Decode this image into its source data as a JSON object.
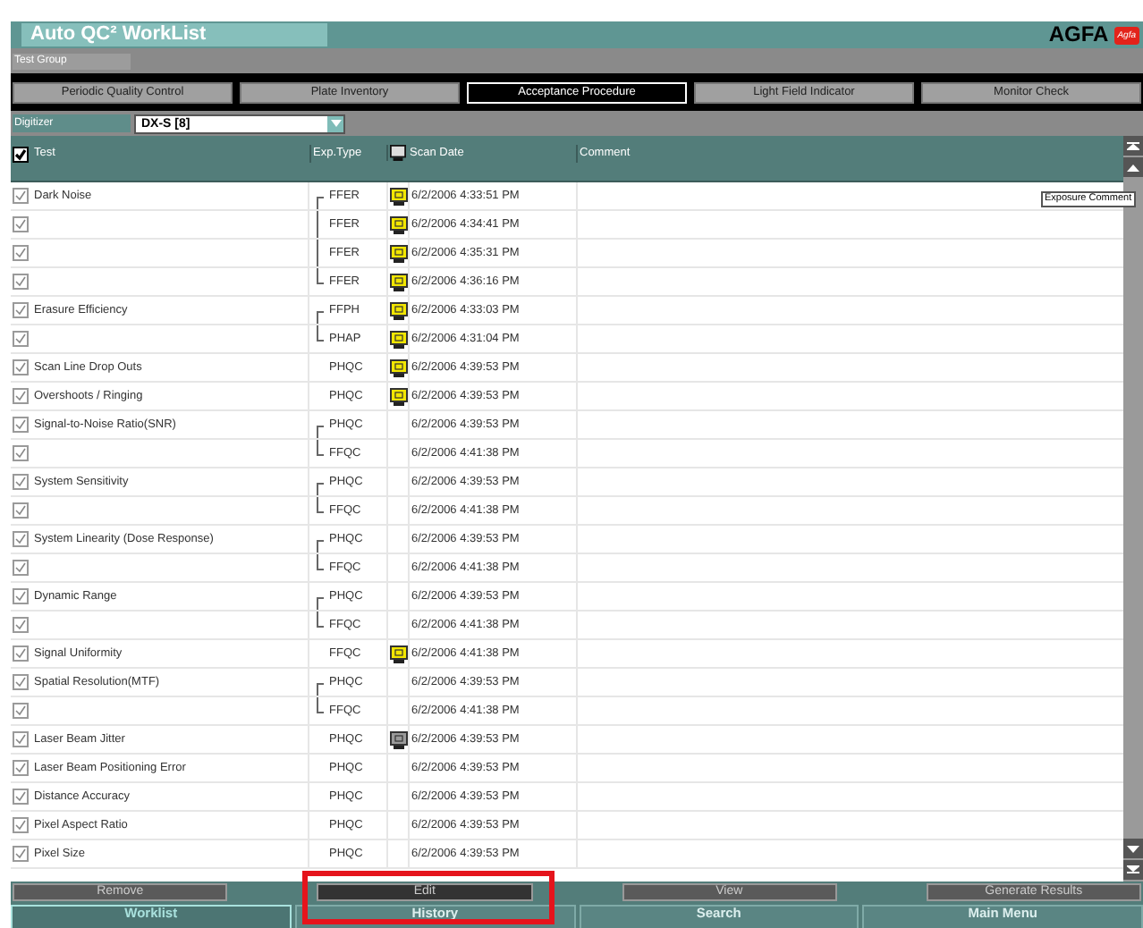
{
  "window": {
    "title": "Auto QC² WorkList",
    "brand": "AGFA",
    "brand_badge": "Agfa"
  },
  "test_group": {
    "label": "Test Group"
  },
  "tabs": [
    {
      "label": "Periodic Quality Control",
      "selected": false
    },
    {
      "label": "Plate Inventory",
      "selected": false
    },
    {
      "label": "Acceptance Procedure",
      "selected": true
    },
    {
      "label": "Light Field Indicator",
      "selected": false
    },
    {
      "label": "Monitor Check",
      "selected": false
    }
  ],
  "digitizer": {
    "label": "Digitizer",
    "value": "DX-S [8]"
  },
  "table": {
    "select_all_checked": true,
    "columns": [
      "Test",
      "Exp.Type",
      "Scan Date",
      "Comment"
    ],
    "tooltip": "Exposure Comment",
    "rows": [
      {
        "test": "Dark Noise",
        "exposures": [
          {
            "checked": true,
            "exp_type": "FFER",
            "kind": "flagged",
            "scan_date": "6/2/2006 4:33:51 PM"
          },
          {
            "checked": true,
            "exp_type": "FFER",
            "kind": "flagged",
            "scan_date": "6/2/2006 4:34:41 PM"
          },
          {
            "checked": true,
            "exp_type": "FFER",
            "kind": "flagged",
            "scan_date": "6/2/2006 4:35:31 PM"
          },
          {
            "checked": true,
            "exp_type": "FFER",
            "kind": "flagged",
            "scan_date": "6/2/2006 4:36:16 PM"
          }
        ]
      },
      {
        "test": "Erasure Efficiency",
        "exposures": [
          {
            "checked": true,
            "exp_type": "FFPH",
            "kind": "flagged",
            "scan_date": "6/2/2006 4:33:03 PM"
          },
          {
            "checked": true,
            "exp_type": "PHAP",
            "kind": "flagged",
            "scan_date": "6/2/2006 4:31:04 PM"
          }
        ]
      },
      {
        "test": "Scan Line Drop Outs",
        "exposures": [
          {
            "checked": true,
            "exp_type": "PHQC",
            "kind": "flagged",
            "scan_date": "6/2/2006 4:39:53 PM"
          }
        ]
      },
      {
        "test": "Overshoots / Ringing",
        "exposures": [
          {
            "checked": true,
            "exp_type": "PHQC",
            "kind": "flagged",
            "scan_date": "6/2/2006 4:39:53 PM"
          }
        ]
      },
      {
        "test": "Signal-to-Noise Ratio(SNR)",
        "exposures": [
          {
            "checked": true,
            "exp_type": "PHQC",
            "kind": "plain",
            "scan_date": "6/2/2006 4:39:53 PM"
          },
          {
            "checked": true,
            "exp_type": "FFQC",
            "kind": "plain",
            "scan_date": "6/2/2006 4:41:38 PM"
          }
        ]
      },
      {
        "test": "System Sensitivity",
        "exposures": [
          {
            "checked": true,
            "exp_type": "PHQC",
            "kind": "plain",
            "scan_date": "6/2/2006 4:39:53 PM"
          },
          {
            "checked": true,
            "exp_type": "FFQC",
            "kind": "plain",
            "scan_date": "6/2/2006 4:41:38 PM"
          }
        ]
      },
      {
        "test": "System Linearity (Dose Response)",
        "exposures": [
          {
            "checked": true,
            "exp_type": "PHQC",
            "kind": "plain",
            "scan_date": "6/2/2006 4:39:53 PM"
          },
          {
            "checked": true,
            "exp_type": "FFQC",
            "kind": "plain",
            "scan_date": "6/2/2006 4:41:38 PM"
          }
        ]
      },
      {
        "test": "Dynamic Range",
        "exposures": [
          {
            "checked": true,
            "exp_type": "PHQC",
            "kind": "plain",
            "scan_date": "6/2/2006 4:39:53 PM"
          },
          {
            "checked": true,
            "exp_type": "FFQC",
            "kind": "plain",
            "scan_date": "6/2/2006 4:41:38 PM"
          }
        ]
      },
      {
        "test": "Signal Uniformity",
        "exposures": [
          {
            "checked": true,
            "exp_type": "FFQC",
            "kind": "flagged",
            "scan_date": "6/2/2006 4:41:38 PM"
          }
        ]
      },
      {
        "test": "Spatial Resolution(MTF)",
        "exposures": [
          {
            "checked": true,
            "exp_type": "PHQC",
            "kind": "plain",
            "scan_date": "6/2/2006 4:39:53 PM"
          },
          {
            "checked": true,
            "exp_type": "FFQC",
            "kind": "plain",
            "scan_date": "6/2/2006 4:41:38 PM"
          }
        ]
      },
      {
        "test": "Laser Beam Jitter",
        "exposures": [
          {
            "checked": true,
            "exp_type": "PHQC",
            "kind": "viewed",
            "scan_date": "6/2/2006 4:39:53 PM"
          }
        ]
      },
      {
        "test": "Laser Beam Positioning Error",
        "exposures": [
          {
            "checked": true,
            "exp_type": "PHQC",
            "kind": "plain",
            "scan_date": "6/2/2006 4:39:53 PM"
          }
        ]
      },
      {
        "test": "Distance Accuracy",
        "exposures": [
          {
            "checked": true,
            "exp_type": "PHQC",
            "kind": "plain",
            "scan_date": "6/2/2006 4:39:53 PM"
          }
        ]
      },
      {
        "test": "Pixel Aspect Ratio",
        "exposures": [
          {
            "checked": true,
            "exp_type": "PHQC",
            "kind": "plain",
            "scan_date": "6/2/2006 4:39:53 PM"
          }
        ]
      },
      {
        "test": "Pixel Size",
        "exposures": [
          {
            "checked": true,
            "exp_type": "PHQC",
            "kind": "plain",
            "scan_date": "6/2/2006 4:39:53 PM"
          }
        ]
      }
    ]
  },
  "buttons": [
    "Remove",
    "Edit",
    "View",
    "Generate Results"
  ],
  "nav": [
    {
      "label": "Worklist",
      "selected": true
    },
    {
      "label": "History",
      "selected": false
    },
    {
      "label": "Search",
      "selected": false
    },
    {
      "label": "Main Menu",
      "selected": false
    }
  ]
}
